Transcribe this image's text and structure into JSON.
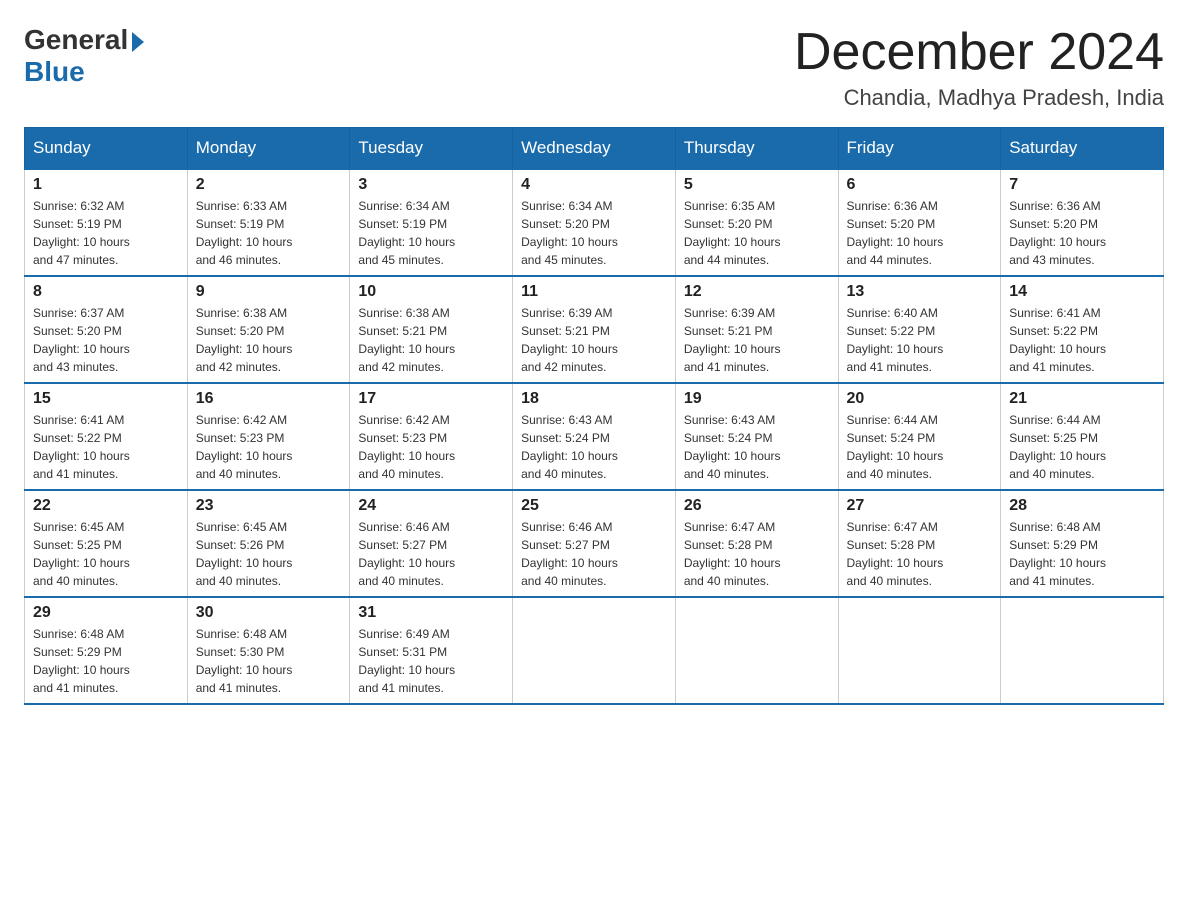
{
  "logo": {
    "general": "General",
    "blue": "Blue"
  },
  "title": "December 2024",
  "location": "Chandia, Madhya Pradesh, India",
  "days_of_week": [
    "Sunday",
    "Monday",
    "Tuesday",
    "Wednesday",
    "Thursday",
    "Friday",
    "Saturday"
  ],
  "weeks": [
    [
      {
        "day": "1",
        "sunrise": "6:32 AM",
        "sunset": "5:19 PM",
        "daylight": "10 hours and 47 minutes."
      },
      {
        "day": "2",
        "sunrise": "6:33 AM",
        "sunset": "5:19 PM",
        "daylight": "10 hours and 46 minutes."
      },
      {
        "day": "3",
        "sunrise": "6:34 AM",
        "sunset": "5:19 PM",
        "daylight": "10 hours and 45 minutes."
      },
      {
        "day": "4",
        "sunrise": "6:34 AM",
        "sunset": "5:20 PM",
        "daylight": "10 hours and 45 minutes."
      },
      {
        "day": "5",
        "sunrise": "6:35 AM",
        "sunset": "5:20 PM",
        "daylight": "10 hours and 44 minutes."
      },
      {
        "day": "6",
        "sunrise": "6:36 AM",
        "sunset": "5:20 PM",
        "daylight": "10 hours and 44 minutes."
      },
      {
        "day": "7",
        "sunrise": "6:36 AM",
        "sunset": "5:20 PM",
        "daylight": "10 hours and 43 minutes."
      }
    ],
    [
      {
        "day": "8",
        "sunrise": "6:37 AM",
        "sunset": "5:20 PM",
        "daylight": "10 hours and 43 minutes."
      },
      {
        "day": "9",
        "sunrise": "6:38 AM",
        "sunset": "5:20 PM",
        "daylight": "10 hours and 42 minutes."
      },
      {
        "day": "10",
        "sunrise": "6:38 AM",
        "sunset": "5:21 PM",
        "daylight": "10 hours and 42 minutes."
      },
      {
        "day": "11",
        "sunrise": "6:39 AM",
        "sunset": "5:21 PM",
        "daylight": "10 hours and 42 minutes."
      },
      {
        "day": "12",
        "sunrise": "6:39 AM",
        "sunset": "5:21 PM",
        "daylight": "10 hours and 41 minutes."
      },
      {
        "day": "13",
        "sunrise": "6:40 AM",
        "sunset": "5:22 PM",
        "daylight": "10 hours and 41 minutes."
      },
      {
        "day": "14",
        "sunrise": "6:41 AM",
        "sunset": "5:22 PM",
        "daylight": "10 hours and 41 minutes."
      }
    ],
    [
      {
        "day": "15",
        "sunrise": "6:41 AM",
        "sunset": "5:22 PM",
        "daylight": "10 hours and 41 minutes."
      },
      {
        "day": "16",
        "sunrise": "6:42 AM",
        "sunset": "5:23 PM",
        "daylight": "10 hours and 40 minutes."
      },
      {
        "day": "17",
        "sunrise": "6:42 AM",
        "sunset": "5:23 PM",
        "daylight": "10 hours and 40 minutes."
      },
      {
        "day": "18",
        "sunrise": "6:43 AM",
        "sunset": "5:24 PM",
        "daylight": "10 hours and 40 minutes."
      },
      {
        "day": "19",
        "sunrise": "6:43 AM",
        "sunset": "5:24 PM",
        "daylight": "10 hours and 40 minutes."
      },
      {
        "day": "20",
        "sunrise": "6:44 AM",
        "sunset": "5:24 PM",
        "daylight": "10 hours and 40 minutes."
      },
      {
        "day": "21",
        "sunrise": "6:44 AM",
        "sunset": "5:25 PM",
        "daylight": "10 hours and 40 minutes."
      }
    ],
    [
      {
        "day": "22",
        "sunrise": "6:45 AM",
        "sunset": "5:25 PM",
        "daylight": "10 hours and 40 minutes."
      },
      {
        "day": "23",
        "sunrise": "6:45 AM",
        "sunset": "5:26 PM",
        "daylight": "10 hours and 40 minutes."
      },
      {
        "day": "24",
        "sunrise": "6:46 AM",
        "sunset": "5:27 PM",
        "daylight": "10 hours and 40 minutes."
      },
      {
        "day": "25",
        "sunrise": "6:46 AM",
        "sunset": "5:27 PM",
        "daylight": "10 hours and 40 minutes."
      },
      {
        "day": "26",
        "sunrise": "6:47 AM",
        "sunset": "5:28 PM",
        "daylight": "10 hours and 40 minutes."
      },
      {
        "day": "27",
        "sunrise": "6:47 AM",
        "sunset": "5:28 PM",
        "daylight": "10 hours and 40 minutes."
      },
      {
        "day": "28",
        "sunrise": "6:48 AM",
        "sunset": "5:29 PM",
        "daylight": "10 hours and 41 minutes."
      }
    ],
    [
      {
        "day": "29",
        "sunrise": "6:48 AM",
        "sunset": "5:29 PM",
        "daylight": "10 hours and 41 minutes."
      },
      {
        "day": "30",
        "sunrise": "6:48 AM",
        "sunset": "5:30 PM",
        "daylight": "10 hours and 41 minutes."
      },
      {
        "day": "31",
        "sunrise": "6:49 AM",
        "sunset": "5:31 PM",
        "daylight": "10 hours and 41 minutes."
      },
      null,
      null,
      null,
      null
    ]
  ],
  "labels": {
    "sunrise": "Sunrise:",
    "sunset": "Sunset:",
    "daylight": "Daylight:"
  },
  "colors": {
    "header_bg": "#1a6bab",
    "header_text": "#ffffff",
    "border": "#999999"
  }
}
